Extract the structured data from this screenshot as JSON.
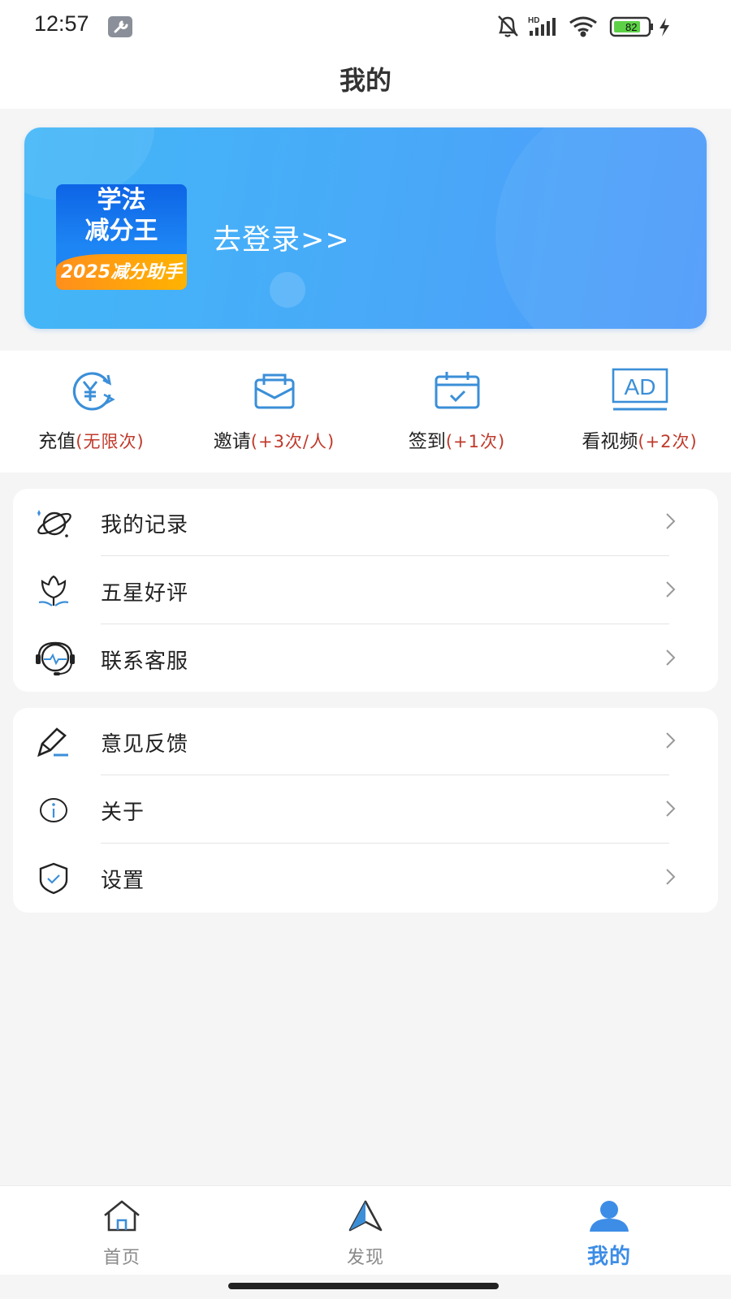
{
  "status_bar": {
    "time": "12:57",
    "network": "HD",
    "battery": "82"
  },
  "header": {
    "title": "我的"
  },
  "banner": {
    "logo_line1": "学法",
    "logo_line2": "减分王",
    "logo_tagline": "2025减分助手",
    "login_text": "去登录>>"
  },
  "quick_actions": [
    {
      "label": "充值",
      "sub": "(无限次)",
      "icon": "yuan-refresh-icon"
    },
    {
      "label": "邀请",
      "sub": "(+3次/人)",
      "icon": "envelope-icon"
    },
    {
      "label": "签到",
      "sub": "(+1次)",
      "icon": "calendar-check-icon"
    },
    {
      "label": "看视频",
      "sub": "(+2次)",
      "icon": "ad-icon",
      "icon_text": "AD"
    }
  ],
  "menu_group1": [
    {
      "label": "我的记录",
      "icon": "planet-icon"
    },
    {
      "label": "五星好评",
      "icon": "lotus-icon"
    },
    {
      "label": "联系客服",
      "icon": "headset-icon"
    }
  ],
  "menu_group2": [
    {
      "label": "意见反馈",
      "icon": "pencil-icon"
    },
    {
      "label": "关于",
      "icon": "info-icon"
    },
    {
      "label": "设置",
      "icon": "shield-check-icon"
    }
  ],
  "bottom_nav": [
    {
      "label": "首页",
      "icon": "home-icon",
      "active": false
    },
    {
      "label": "发现",
      "icon": "compass-arrow-icon",
      "active": false
    },
    {
      "label": "我的",
      "icon": "user-icon",
      "active": true
    }
  ],
  "colors": {
    "accent": "#3d8de6",
    "sub_text_red": "#c0392b",
    "banner_start": "#43b7f7",
    "banner_end": "#4f9bfa"
  }
}
